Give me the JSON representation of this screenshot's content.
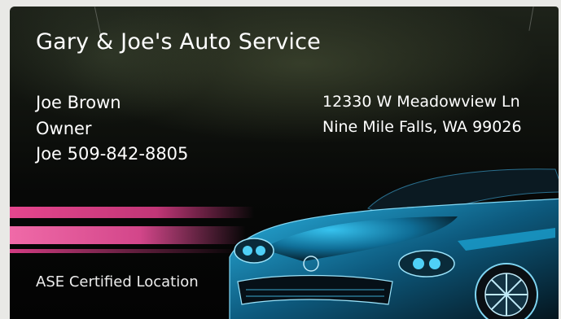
{
  "card": {
    "business_name": "Gary & Joe's Auto Service",
    "contact_name": "Joe Brown",
    "contact_title": "Owner",
    "contact_phone": "Joe 509-842-8805",
    "address_line1": "12330 W Meadowview Ln",
    "address_line2": "Nine Mile Falls, WA 99026",
    "certification": "ASE Certified Location"
  },
  "colors": {
    "background": "#070807",
    "stripe_accent": "#e5468e",
    "car_accent": "#1ea7d6",
    "text": "#ffffff"
  }
}
